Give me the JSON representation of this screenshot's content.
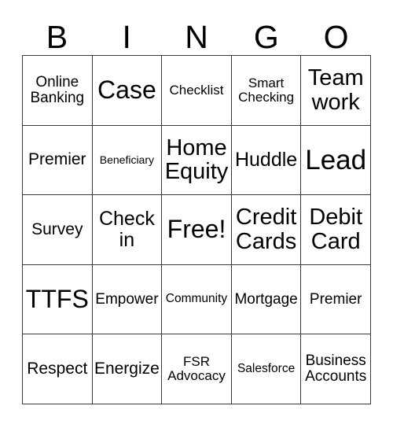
{
  "card": {
    "title_letters": [
      "B",
      "I",
      "N",
      "G",
      "O"
    ],
    "free_space_label": "Free!",
    "border_color": "#3a3a3a",
    "text_color": "#000000",
    "background_color": "#ffffff",
    "rows": [
      [
        {
          "label": "Online\nBanking",
          "size": "sz-m"
        },
        {
          "label": "Case",
          "size": "sz-xxl"
        },
        {
          "label": "Checklist",
          "size": "sz-sm"
        },
        {
          "label": "Smart\nChecking",
          "size": "sz-sm"
        },
        {
          "label": "Team\nwork",
          "size": "sz-xl"
        }
      ],
      [
        {
          "label": "Premier",
          "size": "sz-ml"
        },
        {
          "label": "Beneficiary",
          "size": "sz-xs"
        },
        {
          "label": "Home\nEquity",
          "size": "sz-xl"
        },
        {
          "label": "Huddle",
          "size": "sz-l"
        },
        {
          "label": "Lead",
          "size": "sz-xxxl"
        }
      ],
      [
        {
          "label": "Survey",
          "size": "sz-ml"
        },
        {
          "label": "Check\nin",
          "size": "sz-l"
        },
        {
          "label": "Free!",
          "size": "sz-xxl"
        },
        {
          "label": "Credit\nCards",
          "size": "sz-xl"
        },
        {
          "label": "Debit\nCard",
          "size": "sz-xl"
        }
      ],
      [
        {
          "label": "TTFS",
          "size": "sz-xxl"
        },
        {
          "label": "Empower",
          "size": "sz-m"
        },
        {
          "label": "Community",
          "size": "sz-s"
        },
        {
          "label": "Mortgage",
          "size": "sz-m"
        },
        {
          "label": "Premier",
          "size": "sz-m"
        }
      ],
      [
        {
          "label": "Respect",
          "size": "sz-ml"
        },
        {
          "label": "Energize",
          "size": "sz-ml"
        },
        {
          "label": "FSR\nAdvocacy",
          "size": "sz-sm"
        },
        {
          "label": "Salesforce",
          "size": "sz-s"
        },
        {
          "label": "Business\nAccounts",
          "size": "sz-m"
        }
      ]
    ]
  }
}
